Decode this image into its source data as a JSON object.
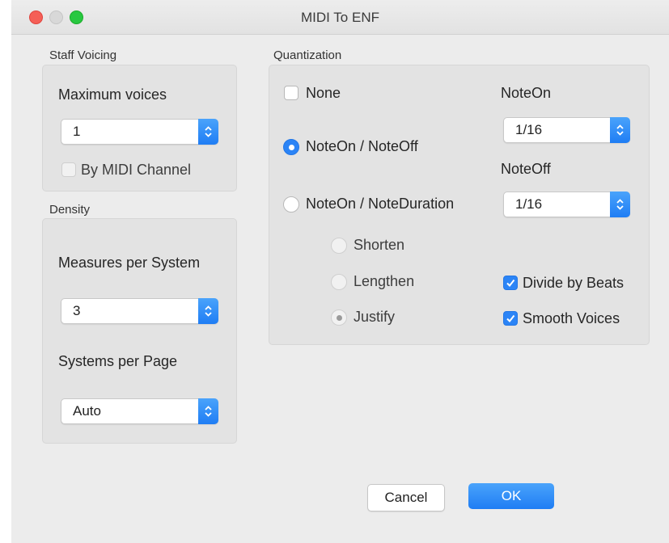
{
  "window": {
    "title": "MIDI To ENF"
  },
  "staff_voicing": {
    "group_label": "Staff Voicing",
    "max_voices_label": "Maximum voices",
    "max_voices_value": "1",
    "by_midi_channel_label": "By MIDI Channel",
    "by_midi_channel_checked": false
  },
  "density": {
    "group_label": "Density",
    "measures_label": "Measures per System",
    "measures_value": "3",
    "systems_label": "Systems per Page",
    "systems_value": "Auto"
  },
  "quantization": {
    "group_label": "Quantization",
    "none_label": "None",
    "noteon_noteoff_label": "NoteOn / NoteOff",
    "noteon_noteduration_label": "NoteOn / NoteDuration",
    "selected_mode": "NoteOn / NoteOff",
    "shorten_label": "Shorten",
    "lengthen_label": "Lengthen",
    "justify_label": "Justify",
    "noteon_label": "NoteOn",
    "noteon_value": "1/16",
    "noteoff_label": "NoteOff",
    "noteoff_value": "1/16",
    "divide_by_beats_label": "Divide by Beats",
    "divide_by_beats_checked": true,
    "smooth_voices_label": "Smooth Voices",
    "smooth_voices_checked": true
  },
  "buttons": {
    "cancel_label": "Cancel",
    "ok_label": "OK"
  },
  "colors": {
    "accent": "#2b84f6",
    "close": "#f55f57",
    "zoom": "#28c840"
  }
}
